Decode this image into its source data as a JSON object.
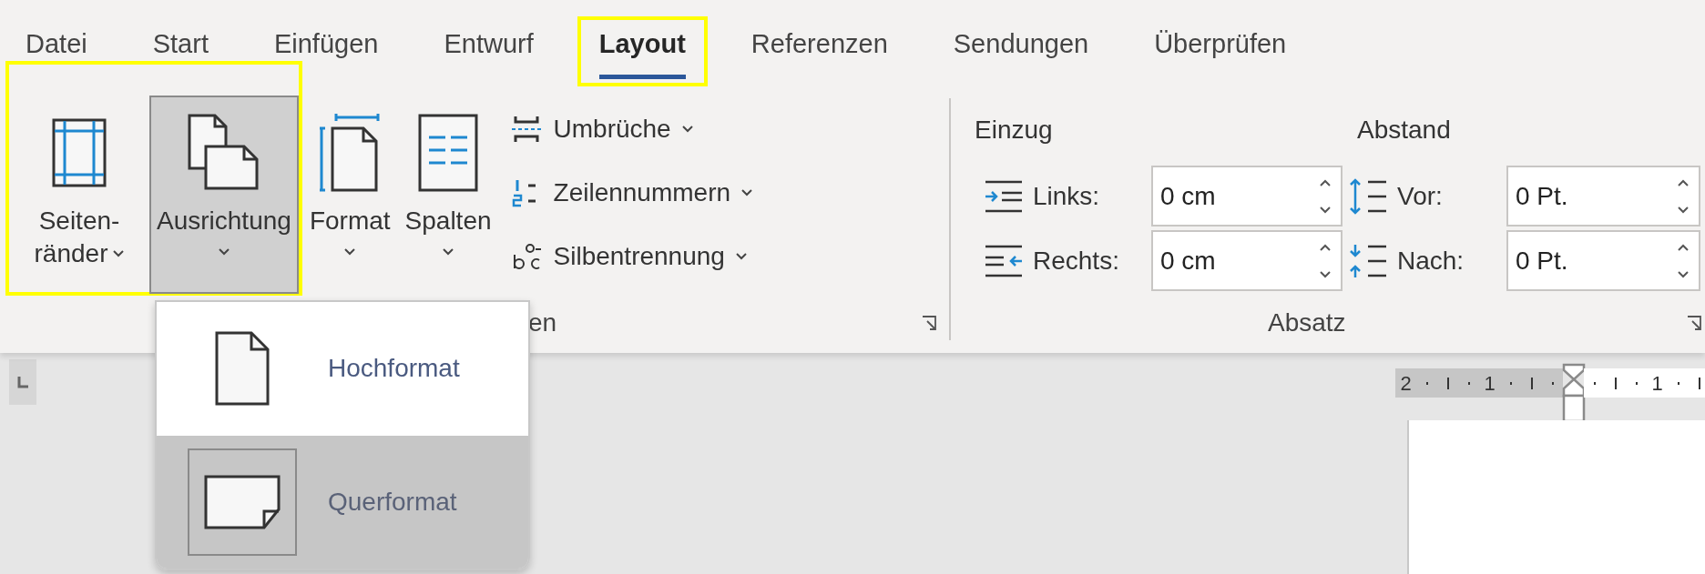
{
  "tabs": [
    {
      "label": "Datei",
      "selected": false,
      "highlighted": false
    },
    {
      "label": "Start",
      "selected": false,
      "highlighted": false
    },
    {
      "label": "Einfügen",
      "selected": false,
      "highlighted": false
    },
    {
      "label": "Entwurf",
      "selected": false,
      "highlighted": false
    },
    {
      "label": "Layout",
      "selected": true,
      "highlighted": true
    },
    {
      "label": "Referenzen",
      "selected": false,
      "highlighted": false
    },
    {
      "label": "Sendungen",
      "selected": false,
      "highlighted": false
    },
    {
      "label": "Überprüfen",
      "selected": false,
      "highlighted": false
    }
  ],
  "page_setup_group": {
    "label": "en",
    "large_buttons": [
      {
        "label": "Seiten-\nränder",
        "kind": "margins",
        "selected": false,
        "highlighted": true
      },
      {
        "label": "Ausrichtung",
        "kind": "orientation",
        "selected": true,
        "highlighted": true
      },
      {
        "label": "Format",
        "kind": "size",
        "selected": false,
        "highlighted": false
      },
      {
        "label": "Spalten",
        "kind": "columns",
        "selected": false,
        "highlighted": false
      }
    ],
    "small_buttons": [
      {
        "label": "Umbrüche",
        "kind": "breaks"
      },
      {
        "label": "Zeilennummern",
        "kind": "line_numbers"
      },
      {
        "label": "Silbentrennung",
        "kind": "hyphenation"
      }
    ]
  },
  "paragraph_group": {
    "label": "Absatz",
    "indent": {
      "heading": "Einzug",
      "fields": [
        {
          "label": "Links:",
          "value": "0 cm",
          "kind": "indent_left"
        },
        {
          "label": "Rechts:",
          "value": "0 cm",
          "kind": "indent_right"
        }
      ]
    },
    "spacing": {
      "heading": "Abstand",
      "fields": [
        {
          "label": "Vor:",
          "value": "0 Pt.",
          "kind": "space_before"
        },
        {
          "label": "Nach:",
          "value": "0 Pt.",
          "kind": "space_after"
        }
      ]
    }
  },
  "orientation_menu": {
    "items": [
      {
        "label": "Hochformat",
        "kind": "portrait",
        "selected": false
      },
      {
        "label": "Querformat",
        "kind": "landscape",
        "selected": true
      }
    ]
  },
  "ruler": {
    "labels": [
      "2",
      "1",
      "1"
    ]
  }
}
